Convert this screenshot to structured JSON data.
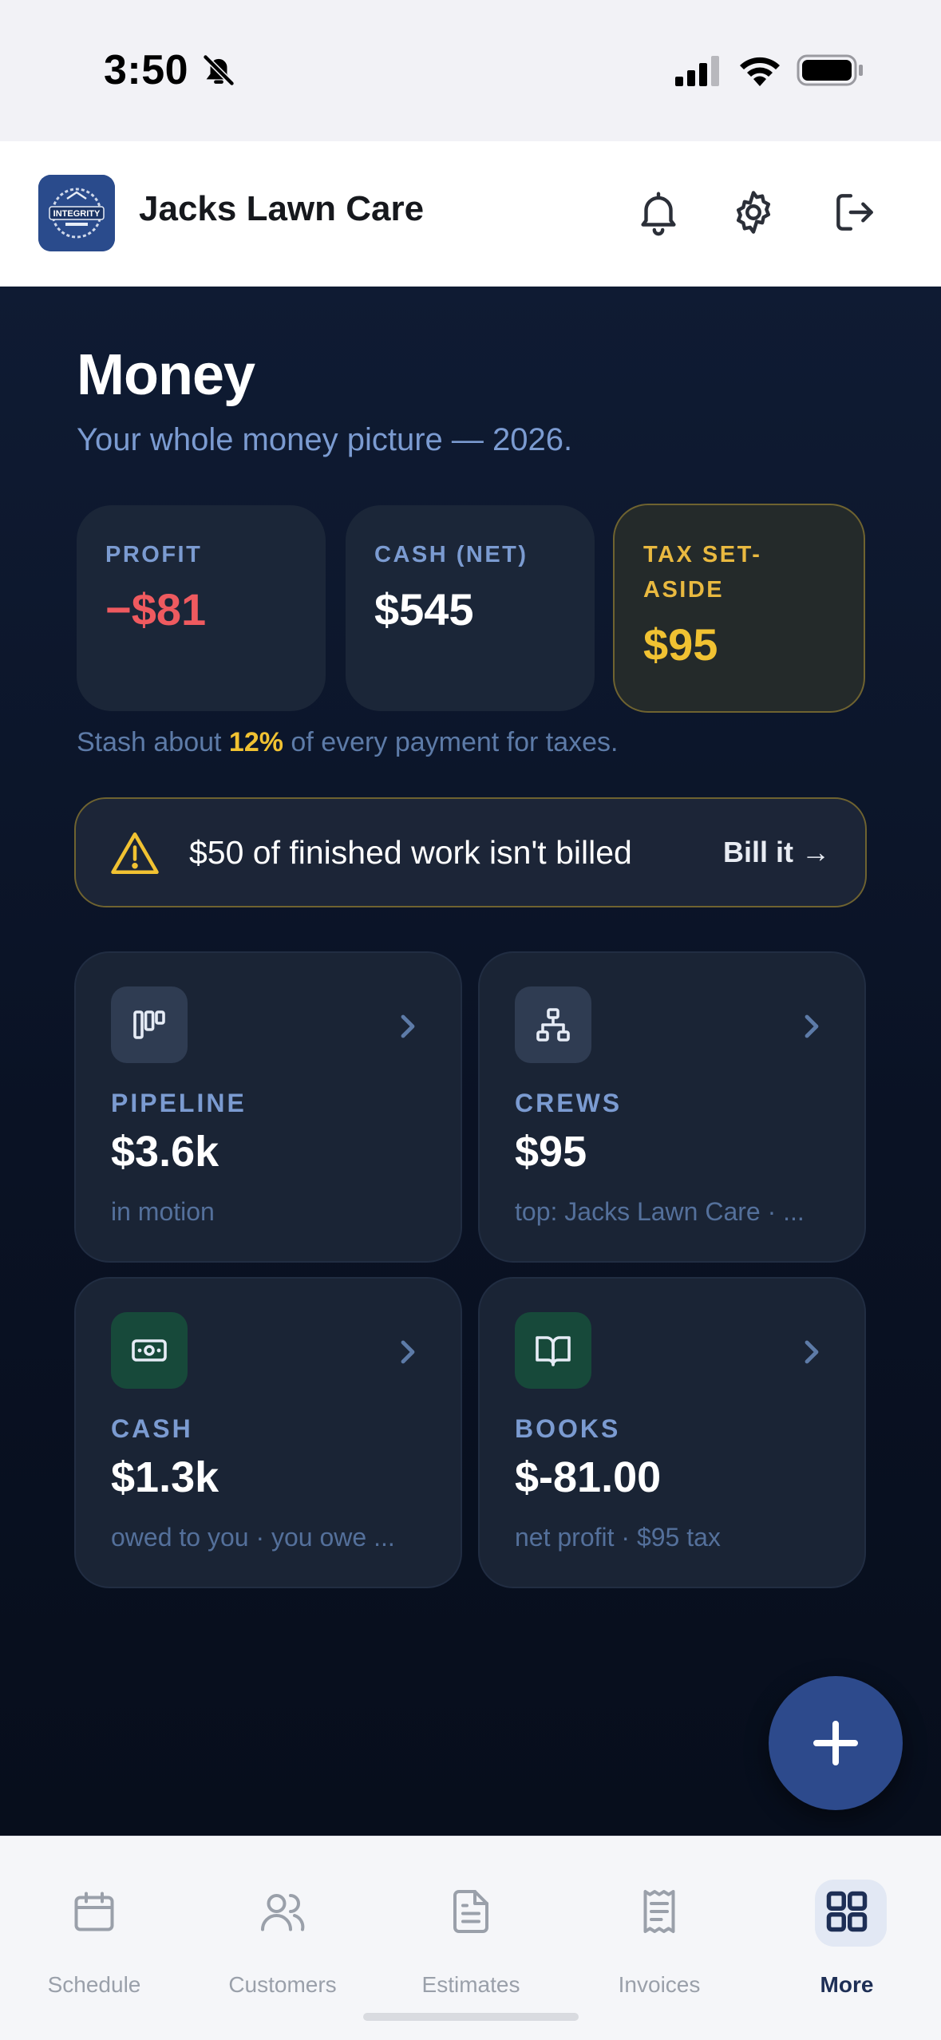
{
  "status_bar": {
    "time": "3:50"
  },
  "header": {
    "app_name": "Jacks Lawn Care",
    "logo_text": "INTEGRITY"
  },
  "page": {
    "title": "Money",
    "subtitle": "Your whole money picture — 2026."
  },
  "stats": [
    {
      "label": "PROFIT",
      "value": "−$81"
    },
    {
      "label": "CASH (NET)",
      "value": "$545"
    },
    {
      "label": "TAX SET-ASIDE",
      "value": "$95"
    }
  ],
  "tax_note": {
    "prefix": "Stash about ",
    "percent": "12%",
    "suffix": " of every payment for taxes."
  },
  "alert": {
    "text": "$50 of finished work isn't billed",
    "action": "Bill it →"
  },
  "tiles": [
    {
      "label": "PIPELINE",
      "value": "$3.6k",
      "sub": "in motion",
      "icon": "kanban-icon"
    },
    {
      "label": "CREWS",
      "value": "$95",
      "sub": "top: Jacks Lawn Care · ...",
      "icon": "org-chart-icon"
    },
    {
      "label": "CASH",
      "value": "$1.3k",
      "sub": "owed to you · you owe ...",
      "icon": "banknote-icon"
    },
    {
      "label": "BOOKS",
      "value": "$-81.00",
      "sub": "net profit · $95 tax",
      "icon": "book-open-icon"
    }
  ],
  "nav": [
    {
      "label": "Schedule",
      "icon": "calendar-icon"
    },
    {
      "label": "Customers",
      "icon": "users-icon"
    },
    {
      "label": "Estimates",
      "icon": "document-icon"
    },
    {
      "label": "Invoices",
      "icon": "receipt-icon"
    },
    {
      "label": "More",
      "icon": "grid-icon",
      "active": true
    }
  ],
  "colors": {
    "negative": "#ef5a5f",
    "tax_accent": "#f1c232",
    "accent_blue": "#2d4a8c",
    "label_blue": "#7b9bd1"
  }
}
